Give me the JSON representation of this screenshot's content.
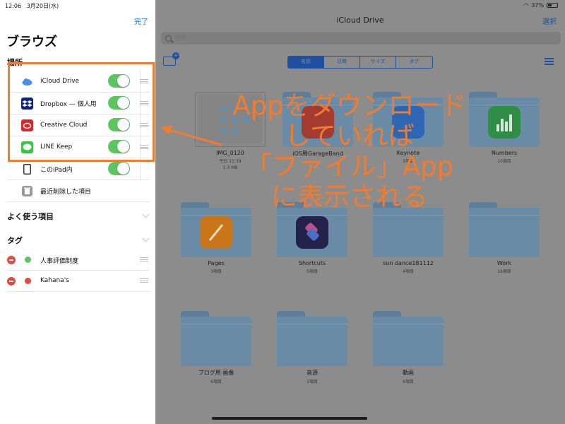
{
  "status_bar": {
    "time": "12:06",
    "date": "3月20日(水)",
    "battery": "37%"
  },
  "sidebar": {
    "done_label": "完了",
    "title": "ブラウズ",
    "locations_label": "場所",
    "locations": [
      {
        "label": "iCloud Drive",
        "icon": "icloud-icon",
        "color": "#4a90e2",
        "toggle": true
      },
      {
        "label": "Dropbox — 個人用",
        "icon": "dropbox-icon",
        "color": "#0d2481",
        "toggle": true
      },
      {
        "label": "Creative Cloud",
        "icon": "creative-cloud-icon",
        "color": "#d8262c",
        "toggle": true
      },
      {
        "label": "LINE Keep",
        "icon": "line-icon",
        "color": "#3ac241",
        "toggle": true
      },
      {
        "label": "このiPad内",
        "icon": "ipad-icon",
        "color": "#3a3a3a",
        "toggle": true
      },
      {
        "label": "最近削除した項目",
        "icon": "trash-icon",
        "color": "#9a9a9a",
        "toggle": false
      }
    ],
    "favorites_label": "よく使う項目",
    "tags_label": "タグ",
    "tags": [
      {
        "label": "人事評価制度",
        "color": "#5bc55f"
      },
      {
        "label": "Kahana's",
        "color": "#e5483e"
      }
    ]
  },
  "main": {
    "title": "iCloud Drive",
    "select_label": "選択",
    "search_placeholder": "検索",
    "sort_tabs": [
      "名前",
      "日時",
      "サイズ",
      "タグ"
    ],
    "items": [
      {
        "name": "IMG_0120",
        "sub1": "今日 11:39",
        "sub2": "1.3 MB",
        "kind": "thumb"
      },
      {
        "name": "iOS用GarageBand",
        "sub1": "",
        "sub2": "",
        "kind": "app",
        "color": "#c0392b"
      },
      {
        "name": "Keynote",
        "sub1": "3項目",
        "sub2": "",
        "kind": "app",
        "color": "#2a6fcf"
      },
      {
        "name": "Numbers",
        "sub1": "10項目",
        "sub2": "",
        "kind": "app",
        "color": "#2ea44f"
      },
      {
        "name": "Pages",
        "sub1": "3項目",
        "sub2": "",
        "kind": "app",
        "color": "#e88a1a"
      },
      {
        "name": "Shortcuts",
        "sub1": "5項目",
        "sub2": "",
        "kind": "app",
        "color": "#2b2b5c"
      },
      {
        "name": "sun dance181112",
        "sub1": "4項目",
        "sub2": "",
        "kind": "folder"
      },
      {
        "name": "Work",
        "sub1": "16項目",
        "sub2": "",
        "kind": "folder"
      },
      {
        "name": "ブログ用 画像",
        "sub1": "6項目",
        "sub2": "",
        "kind": "folder"
      },
      {
        "name": "音源",
        "sub1": "1項目",
        "sub2": "",
        "kind": "folder"
      },
      {
        "name": "動画",
        "sub1": "6項目",
        "sub2": "",
        "kind": "folder"
      }
    ]
  },
  "annotation": {
    "lines": [
      "Appをダウンロード",
      "していれば",
      "「ファイル」App",
      "に表示される"
    ],
    "color": "#f07c32"
  }
}
